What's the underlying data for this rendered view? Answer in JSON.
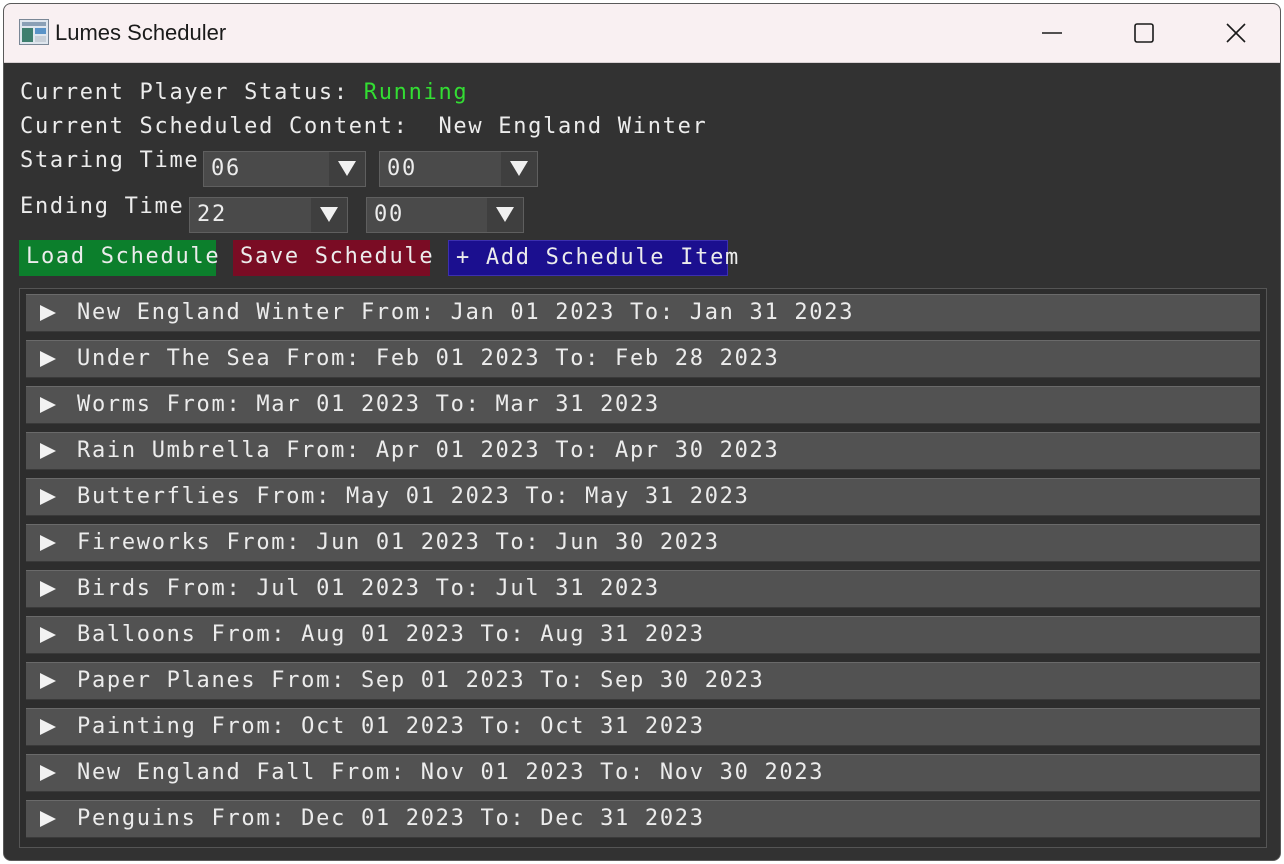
{
  "window": {
    "title": "Lumes Scheduler"
  },
  "status": {
    "player_label": "Current Player Status:",
    "player_value": "Running",
    "content_label": "Current Scheduled Content:",
    "content_value": "New England Winter"
  },
  "starting_time": {
    "label": "Staring Time",
    "hour": "06",
    "minute": "00"
  },
  "ending_time": {
    "label": "Ending Time",
    "hour": "22",
    "minute": "00"
  },
  "buttons": {
    "load": "Load Schedule",
    "save": "Save Schedule",
    "add": "+ Add Schedule Item"
  },
  "schedule": [
    {
      "text": "New England Winter From: Jan 01 2023 To: Jan 31 2023"
    },
    {
      "text": "Under The Sea From: Feb 01 2023 To: Feb 28 2023"
    },
    {
      "text": "Worms From: Mar 01 2023 To: Mar 31 2023"
    },
    {
      "text": "Rain Umbrella From: Apr 01 2023 To: Apr 30 2023"
    },
    {
      "text": "Butterflies From: May 01 2023 To: May 31 2023"
    },
    {
      "text": "Fireworks From: Jun 01 2023 To: Jun 30 2023"
    },
    {
      "text": "Birds From: Jul 01 2023 To: Jul 31 2023"
    },
    {
      "text": "Balloons From: Aug 01 2023 To: Aug 31 2023"
    },
    {
      "text": "Paper Planes From: Sep 01 2023 To: Sep 30 2023"
    },
    {
      "text": "Painting From: Oct 01 2023 To: Oct 31 2023"
    },
    {
      "text": "New England Fall From: Nov 01 2023 To: Nov 30 2023"
    },
    {
      "text": "Penguins From: Dec 01 2023 To: Dec 31 2023"
    }
  ],
  "colors": {
    "running": "#33dd33",
    "load_button": "#0c7f2c",
    "save_button": "#7a0c24",
    "add_button": "#1b0f8f"
  },
  "icons": {
    "app": "app-icon",
    "minimize": "minimize-icon",
    "maximize": "maximize-icon",
    "close": "close-icon",
    "dropdown": "triangle-down-icon",
    "expand": "triangle-right-icon"
  }
}
